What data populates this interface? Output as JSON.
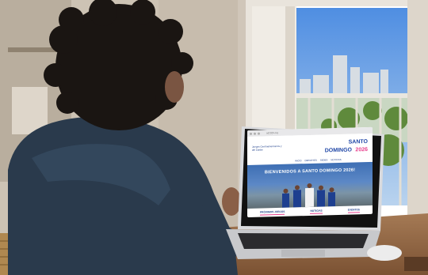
{
  "colors": {
    "wall": "#cfc6b8",
    "sky": "#6aa3e6",
    "hoodie": "#283848",
    "site_blue": "#1f46a6",
    "site_pink": "#e8418e"
  },
  "browser": {
    "url": "sd2026.org"
  },
  "website": {
    "tagline": "Juegos Centroamericanos y del Caribe",
    "logo_line1": "SANTO",
    "logo_line2": "DOMINGO",
    "logo_year": "2026",
    "nav": [
      "INICIO",
      "DEPORTES",
      "SEDES",
      "NOTICIAS"
    ],
    "hero_title": "BIENVENIDOS A SANTO DOMINGO 2026!",
    "pager": "• • •",
    "sections": [
      "PRÓXIMOS JUEGOS",
      "NOTICIAS",
      "EVENTOS"
    ]
  }
}
